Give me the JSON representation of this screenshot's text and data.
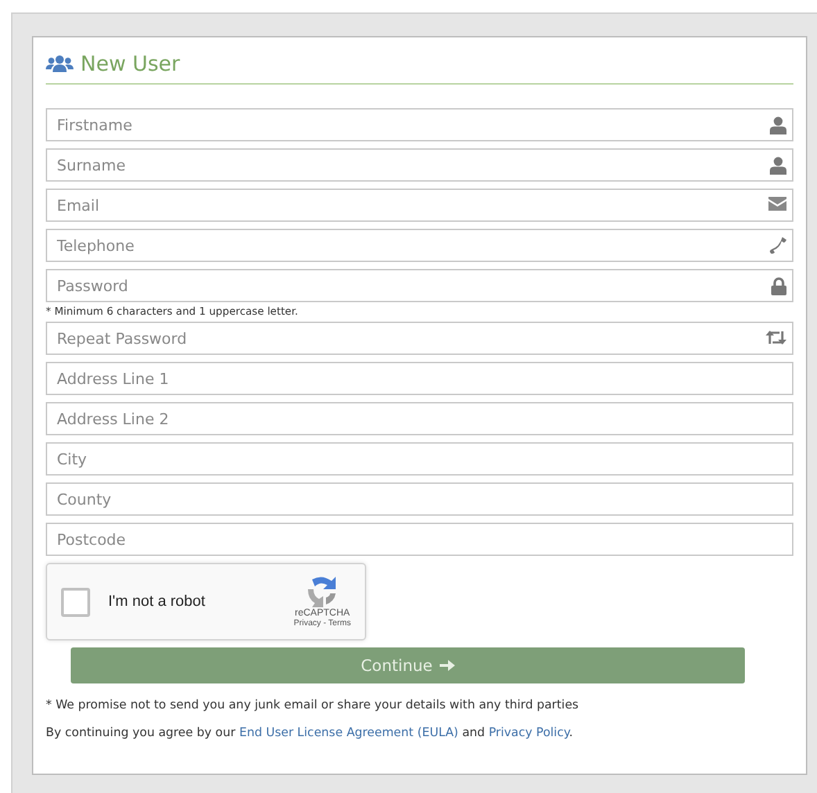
{
  "panel": {
    "title": "New User"
  },
  "fields": [
    {
      "placeholder": "Firstname",
      "kind": "user"
    },
    {
      "placeholder": "Surname",
      "kind": "user"
    },
    {
      "placeholder": "Email",
      "kind": "envelope"
    },
    {
      "placeholder": "Telephone",
      "kind": "phone"
    },
    {
      "placeholder": "Password",
      "kind": "lock",
      "hint": "* Minimum 6 characters and 1 uppercase letter."
    },
    {
      "placeholder": "Repeat Password",
      "kind": "repeat"
    },
    {
      "placeholder": "Address Line 1",
      "kind": "plain"
    },
    {
      "placeholder": "Address Line 2",
      "kind": "plain"
    },
    {
      "placeholder": "City",
      "kind": "plain"
    },
    {
      "placeholder": "County",
      "kind": "plain"
    },
    {
      "placeholder": "Postcode",
      "kind": "plain"
    }
  ],
  "captcha": {
    "label": "I'm not a robot",
    "checked": false,
    "brand": "reCAPTCHA",
    "links": "Privacy - Terms"
  },
  "submit": {
    "label": "Continue"
  },
  "notes": {
    "promise": "* We promise not to send you any junk email or share your details with any third parties",
    "agreement": [
      {
        "kind": "text",
        "text": "By continuing you agree by our "
      },
      {
        "kind": "link",
        "text": "End User License Agreement (EULA)"
      },
      {
        "kind": "text",
        "text": " and "
      },
      {
        "kind": "link",
        "text": "Privacy Policy"
      },
      {
        "kind": "text",
        "text": "."
      }
    ]
  }
}
